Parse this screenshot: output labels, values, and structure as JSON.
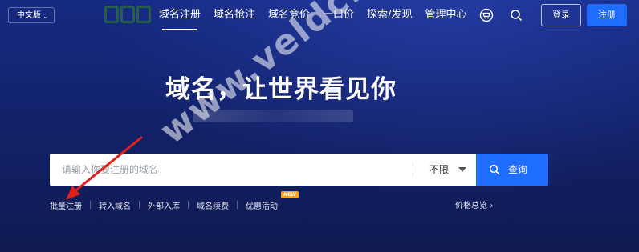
{
  "header": {
    "language": "中文版",
    "nav": [
      "域名注册",
      "域名抢注",
      "域名竞价",
      "一口价",
      "探索/发现",
      "管理中心"
    ],
    "login": "登录",
    "register": "注册"
  },
  "hero": {
    "headline": "域名，让世界看见你"
  },
  "search": {
    "placeholder": "请输入你要注册的域名",
    "select_value": "不限",
    "button": "查询"
  },
  "links": [
    "批量注册",
    "转入域名",
    "外部入库",
    "域名续费",
    "优惠活动"
  ],
  "badge": "NEW",
  "price_overview": "价格总览",
  "watermark": "www.veldc.com",
  "colors": {
    "accent": "#1f6dff",
    "badge": "#ff9f1a",
    "arrow": "#e0201b"
  }
}
